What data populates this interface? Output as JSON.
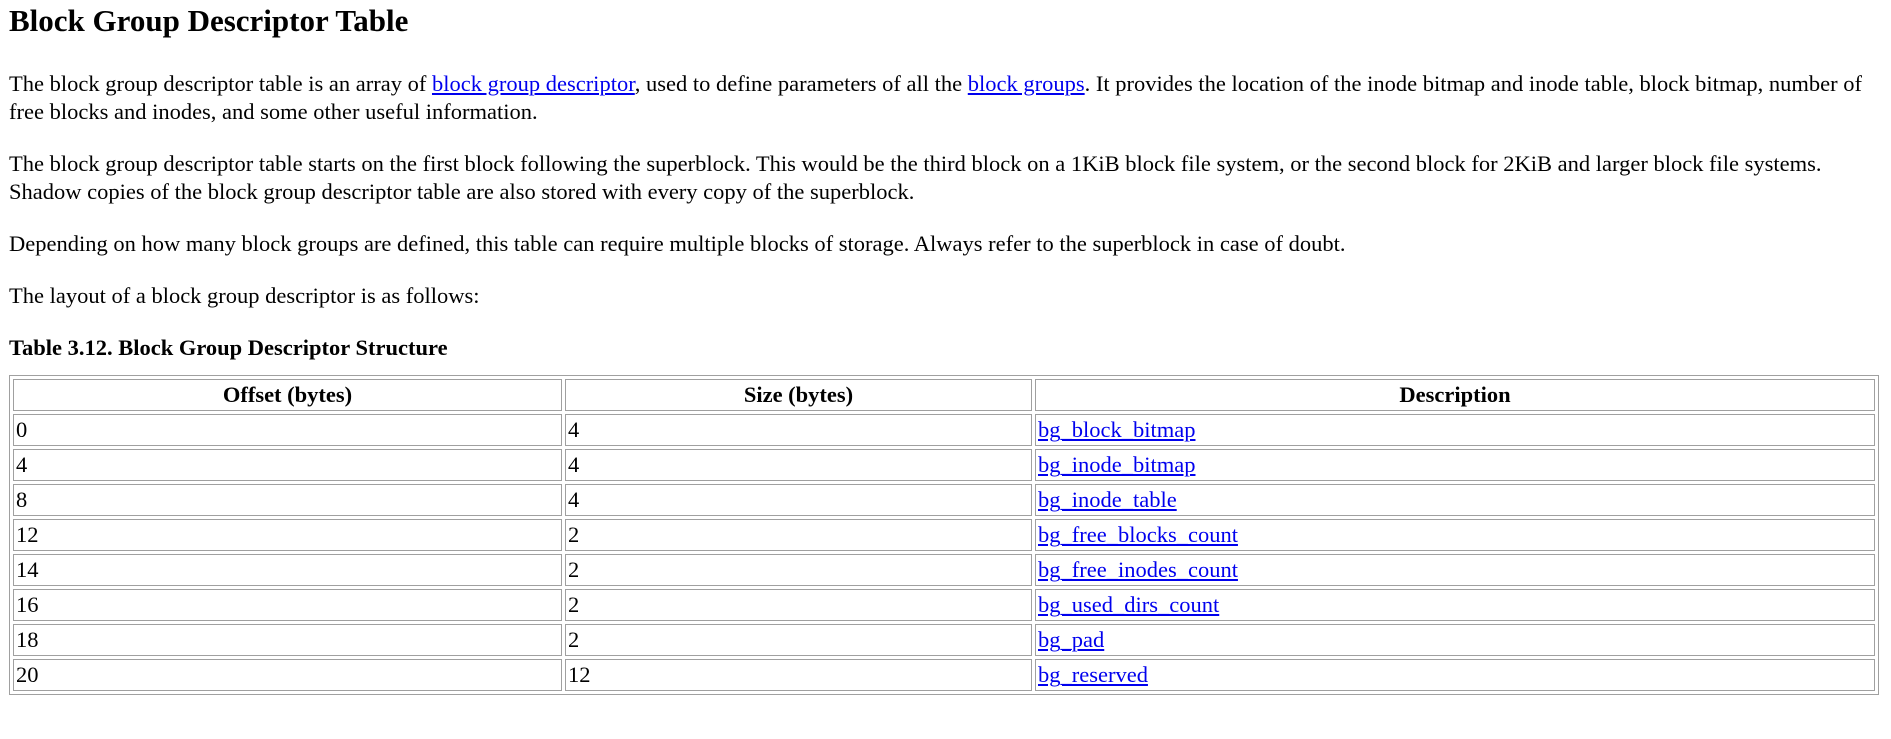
{
  "page": {
    "title": "Block Group Descriptor Table",
    "intro": {
      "text_before_link1": "The block group descriptor table is an array of ",
      "link1": "block group descriptor",
      "text_between_links": ", used to define parameters of all the ",
      "link2": "block groups",
      "text_after_link2": ". It provides the location of the inode bitmap and inode table, block bitmap, number of free blocks and inodes, and some other useful information."
    },
    "paragraph2": "The block group descriptor table starts on the first block following the superblock. This would be the third block on a 1KiB block file system, or the second block for 2KiB and larger block file systems. Shadow copies of the block group descriptor table are also stored with every copy of the superblock.",
    "paragraph3": "Depending on how many block groups are defined, this table can require multiple blocks of storage. Always refer to the superblock in case of doubt.",
    "paragraph4": "The layout of a block group descriptor is as follows:",
    "table_caption": "Table 3.12. Block Group Descriptor Structure"
  },
  "table": {
    "headers": [
      "Offset (bytes)",
      "Size (bytes)",
      "Description"
    ],
    "rows": [
      {
        "offset": "0",
        "size": "4",
        "description": "bg_block_bitmap"
      },
      {
        "offset": "4",
        "size": "4",
        "description": "bg_inode_bitmap"
      },
      {
        "offset": "8",
        "size": "4",
        "description": "bg_inode_table"
      },
      {
        "offset": "12",
        "size": "2",
        "description": "bg_free_blocks_count"
      },
      {
        "offset": "14",
        "size": "2",
        "description": "bg_free_inodes_count"
      },
      {
        "offset": "16",
        "size": "2",
        "description": "bg_used_dirs_count"
      },
      {
        "offset": "18",
        "size": "2",
        "description": "bg_pad"
      },
      {
        "offset": "20",
        "size": "12",
        "description": "bg_reserved"
      }
    ]
  },
  "colors": {
    "link": "#0000ee",
    "table_border": "#a0a0a0"
  }
}
